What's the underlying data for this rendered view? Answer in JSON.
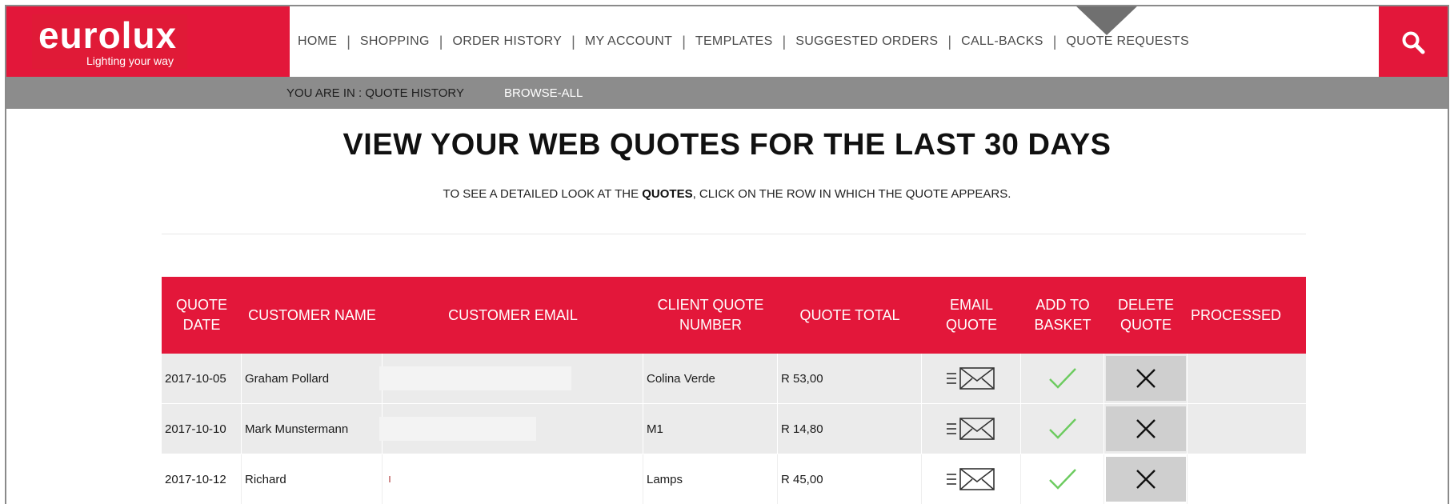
{
  "brand": {
    "name": "eurolux",
    "tagline": "Lighting your way",
    "accent_color": "#e3173a"
  },
  "nav": {
    "items": [
      {
        "label": "HOME"
      },
      {
        "label": "SHOPPING"
      },
      {
        "label": "ORDER HISTORY"
      },
      {
        "label": "MY ACCOUNT"
      },
      {
        "label": "TEMPLATES"
      },
      {
        "label": "SUGGESTED ORDERS"
      },
      {
        "label": "CALL-BACKS"
      },
      {
        "label": "QUOTE REQUESTS"
      }
    ],
    "search_icon": "search-icon"
  },
  "breadcrumb": {
    "label": "YOU ARE IN : QUOTE HISTORY",
    "link": "BROWSE-ALL"
  },
  "page": {
    "title": "VIEW YOUR WEB QUOTES FOR THE LAST 30 DAYS",
    "subtitle_before": "TO SEE A DETAILED LOOK AT THE ",
    "subtitle_bold": "QUOTES",
    "subtitle_after": ", CLICK ON THE ROW IN WHICH THE QUOTE APPEARS."
  },
  "table": {
    "headers": {
      "quote_date": "QUOTE DATE",
      "customer_name": "CUSTOMER NAME",
      "customer_email": "CUSTOMER EMAIL",
      "client_quote_number": "CLIENT QUOTE NUMBER",
      "quote_total": "QUOTE TOTAL",
      "email_quote": "EMAIL QUOTE",
      "add_to_basket": "ADD TO BASKET",
      "delete_quote": "DELETE QUOTE",
      "processed": "PROCESSED"
    },
    "rows": [
      {
        "date": "2017-10-05",
        "name": "Graham Pollard",
        "email": "",
        "client_quote": "Colina Verde",
        "total": "R 53,00",
        "processed": ""
      },
      {
        "date": "2017-10-10",
        "name": "Mark Munstermann",
        "email": "",
        "client_quote": "M1",
        "total": "R 14,80",
        "processed": ""
      },
      {
        "date": "2017-10-12",
        "name": "Richard",
        "email": "",
        "client_quote": "Lamps",
        "total": "R 45,00",
        "processed": ""
      }
    ]
  }
}
